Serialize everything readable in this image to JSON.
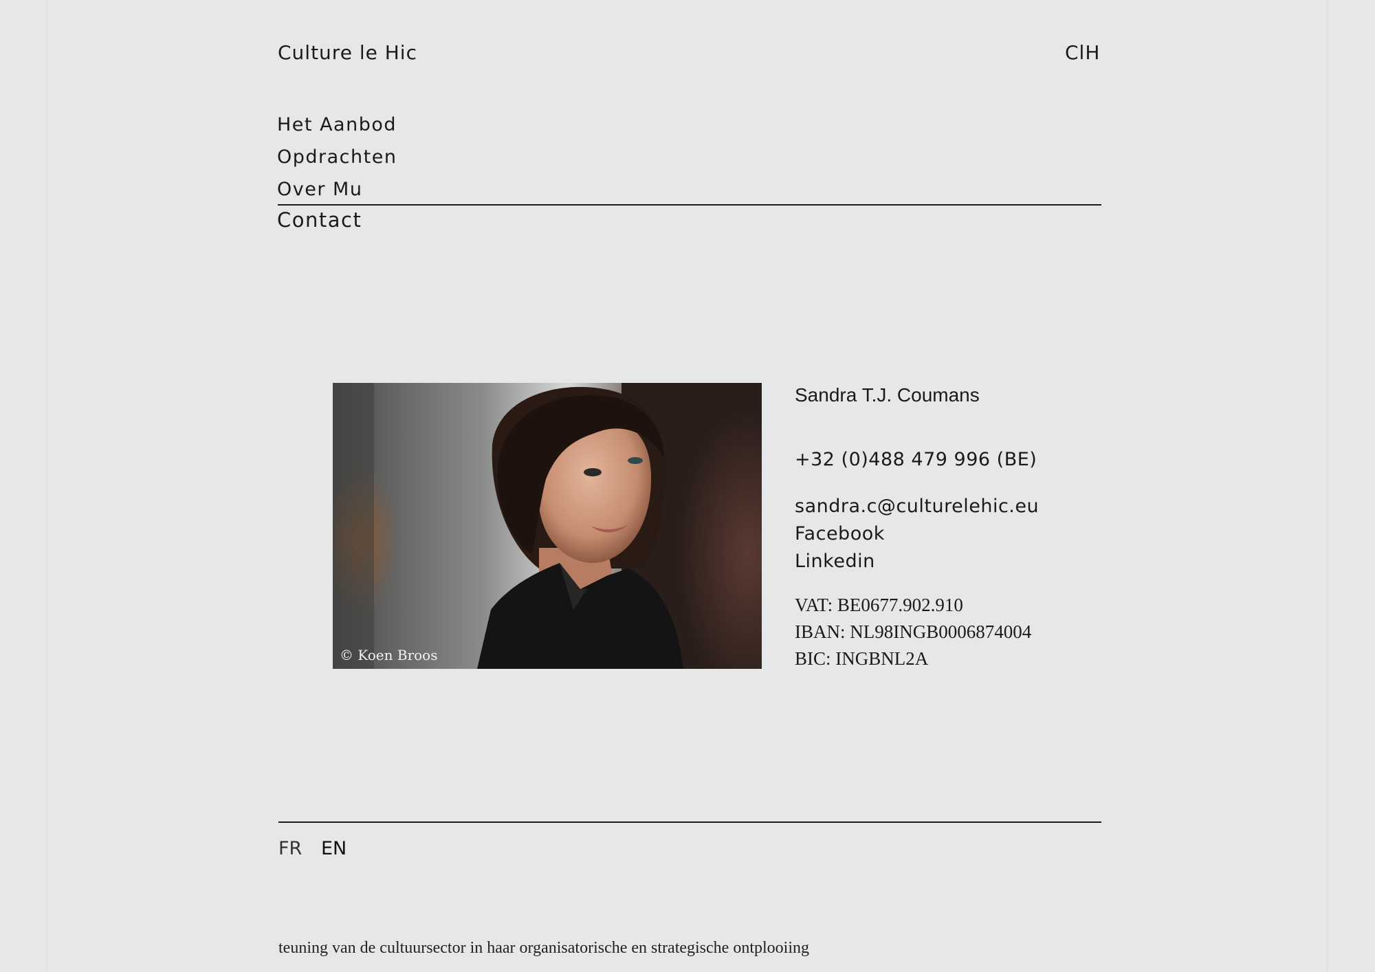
{
  "header": {
    "brand": "Culture le Hic",
    "monogram": "ClH"
  },
  "nav": {
    "items": [
      {
        "label": "Het Aanbod"
      },
      {
        "label": "Opdrachten"
      },
      {
        "label": "Over Mu"
      }
    ],
    "active": "Contact"
  },
  "photo": {
    "credit": "© Koen Broos"
  },
  "contact": {
    "name": "Sandra T.J. Coumans",
    "phone": "+32 (0)488 479 996 (BE)",
    "email": "sandra.c@culturelehic.eu",
    "facebook": "Facebook",
    "linkedin": "Linkedin",
    "vat": "VAT: BE0677.902.910",
    "iban": "IBAN: NL98INGB0006874004",
    "bic": "BIC: INGBNL2A"
  },
  "footer": {
    "languages": [
      "FR",
      "EN"
    ],
    "ticker": "teuning van de cultuursector in haar organisatorische en strategische ontplooiing"
  },
  "colors": {
    "background": "#e6e7e9",
    "text": "#1a1a1a",
    "rule": "#1a1a1a"
  }
}
